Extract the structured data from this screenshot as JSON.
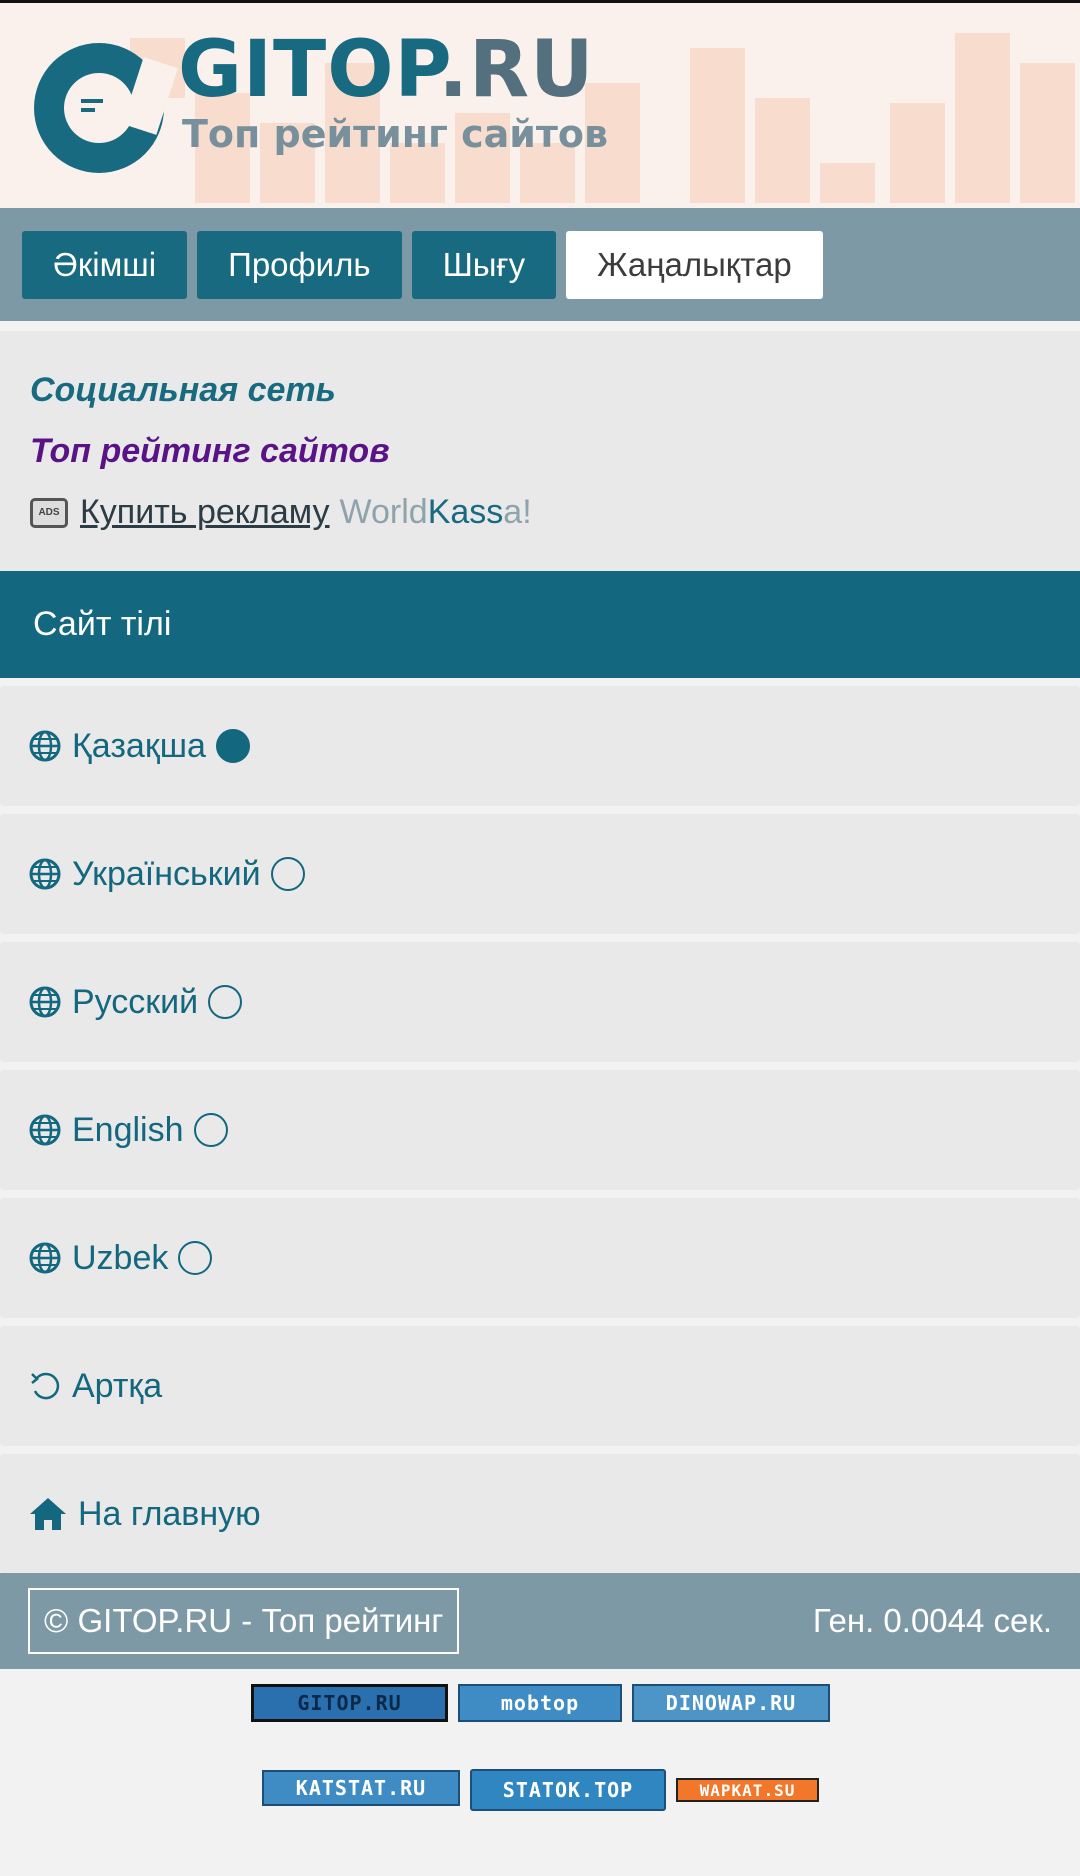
{
  "header": {
    "logo_title": "GITOP",
    "logo_title_suffix": ".RU",
    "logo_subtitle": "Топ рейтинг сайтов"
  },
  "nav": {
    "items": [
      "Әкімші",
      "Профиль",
      "Шығу",
      "Жаңалықтар"
    ],
    "active": "Жаңалықтар"
  },
  "info": {
    "line1": "Социальная сеть",
    "line2": "Топ рейтинг сайтов",
    "ads_icon": "ADS",
    "ad_link": "Купить рекламу",
    "worldkassa_parts": [
      "World",
      "Kass",
      "a!"
    ]
  },
  "section": {
    "title": "Сайт тілі"
  },
  "languages": [
    {
      "label": "Қазақша",
      "selected": true
    },
    {
      "label": "Український",
      "selected": false
    },
    {
      "label": "Русский",
      "selected": false
    },
    {
      "label": "English",
      "selected": false
    },
    {
      "label": "Uzbek",
      "selected": false
    }
  ],
  "actions": {
    "back": "Артқа",
    "home": "На главную"
  },
  "footer": {
    "copyright": "© GITOP.RU - Топ рейтинг",
    "gen_time": "Ген. 0.0044 сек."
  },
  "counters": [
    "GITOP.RU",
    "mobtop",
    "DINOWAP.RU",
    "KATSTAT.RU",
    "STATOK.TOP",
    "WAPKAT.SU"
  ],
  "colors": {
    "primary": "#13677e",
    "nav_bg": "#7d99a5",
    "panel": "#e9e9e9",
    "purple": "#5a1387"
  }
}
